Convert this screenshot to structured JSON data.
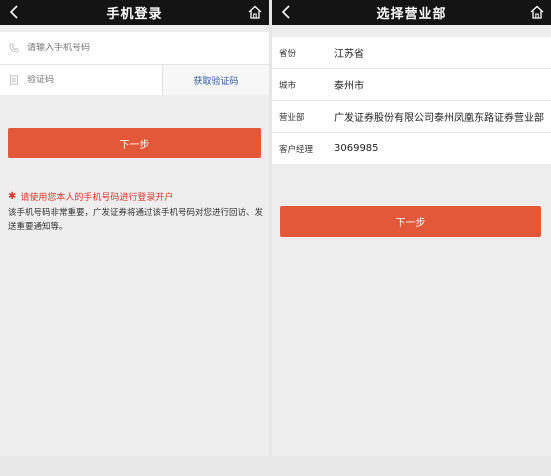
{
  "left": {
    "title": "手机登录",
    "phone_placeholder": "请输入手机号码",
    "code_placeholder": "验证码",
    "get_code": "获取验证码",
    "next": "下一步",
    "warning": "请使用您本人的手机号码进行登录开户",
    "note": "该手机号码非常重要，广发证券将通过该手机号码对您进行回访、发送重要通知等。"
  },
  "right": {
    "title": "选择营业部",
    "rows": [
      {
        "label": "省份",
        "value": "江苏省"
      },
      {
        "label": "城市",
        "value": "泰州市"
      },
      {
        "label": "营业部",
        "value": "广发证券股份有限公司泰州凤凰东路证券营业部"
      },
      {
        "label": "客户经理",
        "value": "3069985"
      }
    ],
    "next": "下一步"
  },
  "icons": {
    "back": "chevron-left-icon",
    "home": "home-icon",
    "phone": "phone-icon",
    "code": "document-icon",
    "warning": "asterisk-icon"
  },
  "colors": {
    "navbar": "#141414",
    "primary_button": "#e35838",
    "link": "#2d5d9c",
    "warning": "#d9392b"
  }
}
